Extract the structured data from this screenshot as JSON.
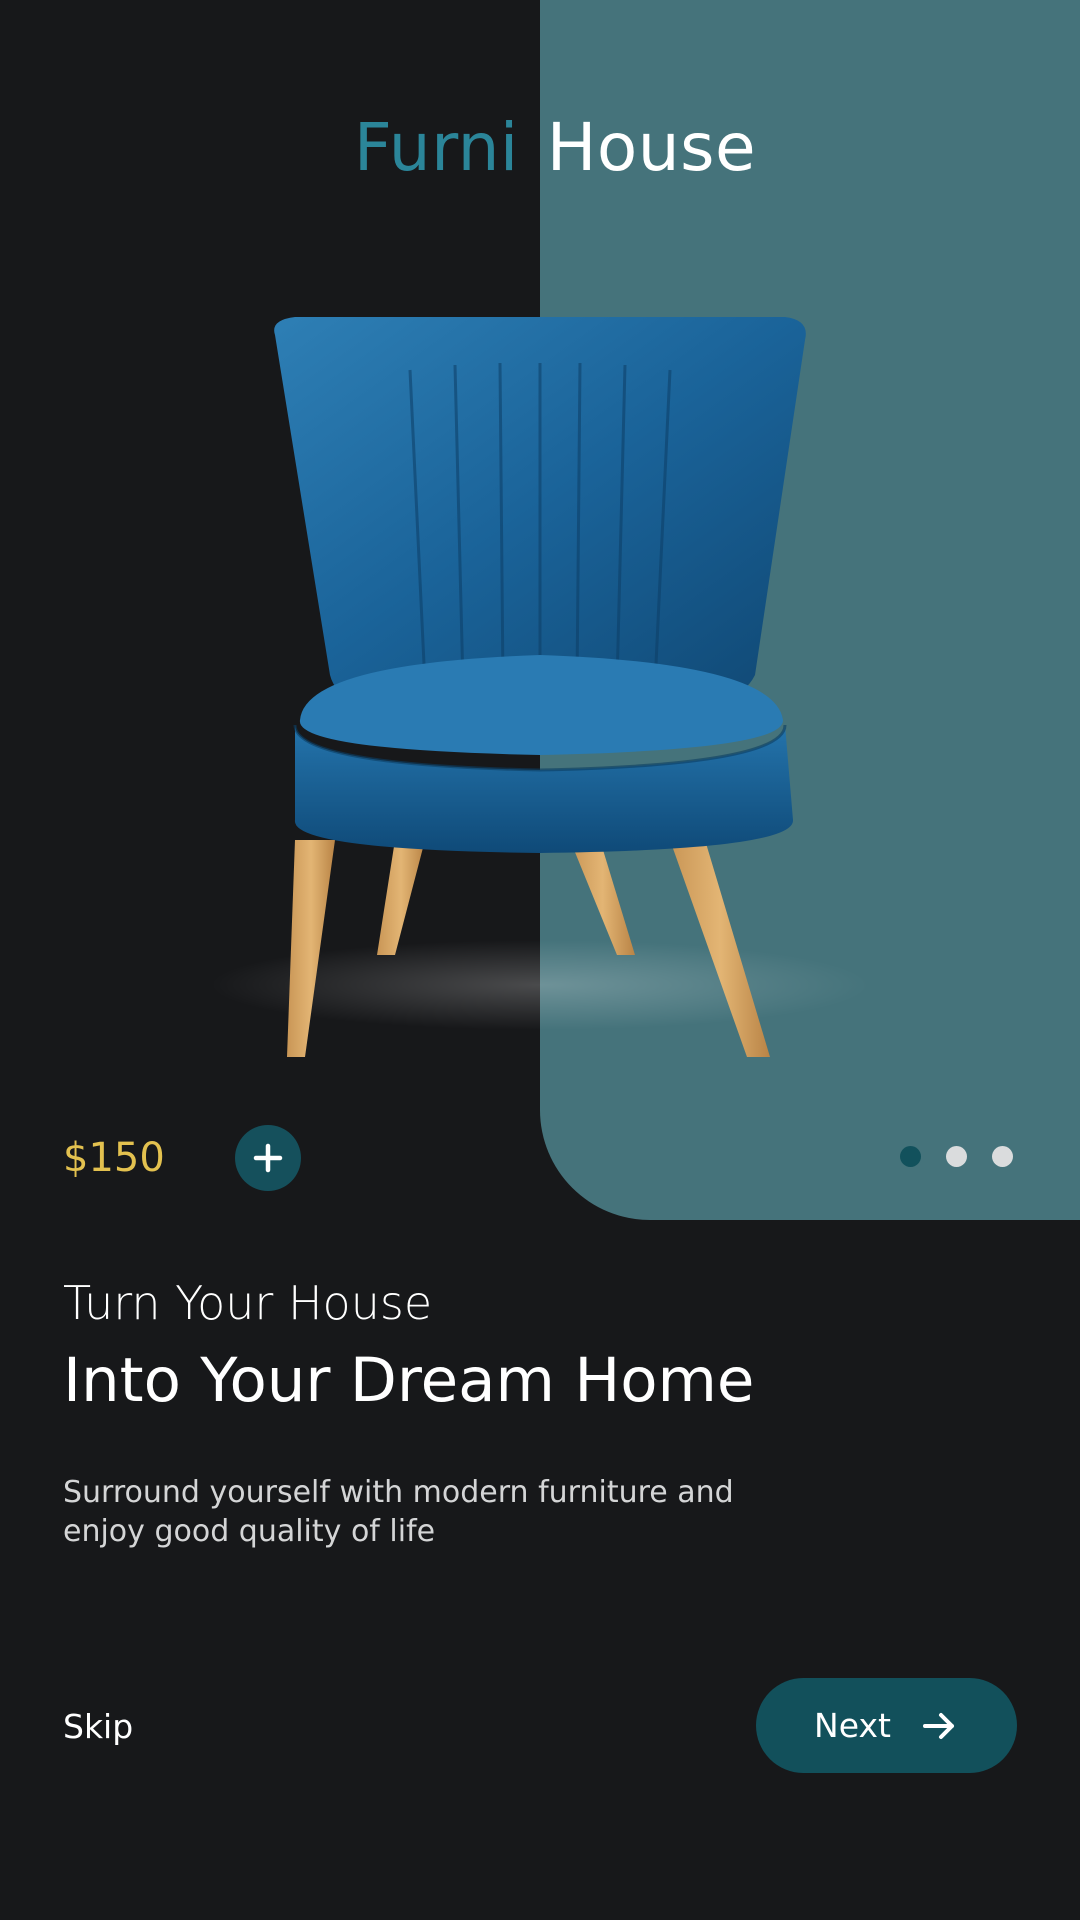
{
  "brand": {
    "part1": "Furni",
    "part2": "House"
  },
  "product": {
    "image": "blue-velvet-armchair",
    "price": "$150",
    "add_icon": "plus-icon"
  },
  "pagination": {
    "total": 3,
    "active_index": 0
  },
  "content": {
    "subhead": "Turn Your House",
    "headline": "Into Your Dream Home",
    "description": "Surround yourself with modern furniture and enjoy good quality of life"
  },
  "actions": {
    "skip_label": "Skip",
    "next_label": "Next",
    "next_icon": "arrow-right-icon"
  },
  "colors": {
    "background": "#17181a",
    "teal_panel": "#45737b",
    "brand_accent": "#2b8599",
    "price": "#e3c14f",
    "button": "#12505b",
    "dot_active": "#12515c",
    "dot_inactive": "#dadcdd"
  }
}
